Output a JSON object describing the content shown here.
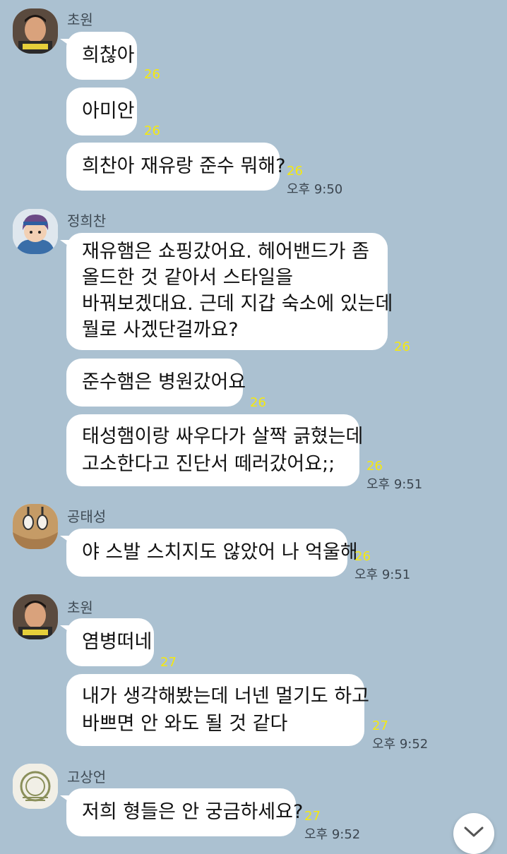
{
  "blocks": [
    {
      "sender": "초원",
      "avatar_icon": "chowon-avatar",
      "messages": [
        {
          "text": "희찮아",
          "count": "26"
        },
        {
          "text": "아미안",
          "count": "26"
        },
        {
          "text": "희찬아 재유랑 준수 뭐해?",
          "count": "26",
          "time": "오후 9:50"
        }
      ]
    },
    {
      "sender": "정희찬",
      "avatar_icon": "heechan-avatar",
      "messages": [
        {
          "lines": [
            "재유햄은 쇼핑갔어요. 헤어밴드가 좀",
            "올드한 것 같아서 스타일을",
            "바꿔보겠대요. 근데 지갑 숙소에 있는데",
            "뭘로 사겠단걸까요?"
          ],
          "count": "26"
        },
        {
          "text": "준수햄은 병원갔어요",
          "count": "26"
        },
        {
          "lines": [
            "태성햄이랑 싸우다가 살짝 긁혔는데",
            "고소한다고 진단서 떼러갔어요;;"
          ],
          "count": "26",
          "time": "오후 9:51"
        }
      ]
    },
    {
      "sender": "공태성",
      "avatar_icon": "taesung-avatar",
      "messages": [
        {
          "text": "야 스발 스치지도 않았어 나 억울해",
          "count": "26",
          "time": "오후 9:51"
        }
      ]
    },
    {
      "sender": "초원",
      "avatar_icon": "chowon-avatar",
      "messages": [
        {
          "text": "염병떠네",
          "count": "27"
        },
        {
          "lines": [
            "내가 생각해봤는데 너넨 멀기도 하고",
            "바쁘면 안 와도 될 것 같다"
          ],
          "count": "27",
          "time": "오후 9:52"
        }
      ]
    },
    {
      "sender": "고상언",
      "avatar_icon": "sangeon-avatar",
      "messages": [
        {
          "text": "저희 형들은 안 궁금하세요?",
          "count": "27",
          "time": "오후 9:52"
        }
      ]
    }
  ],
  "scroll_button_icon": "chevron-down-icon",
  "colors": {
    "background": "#abc1d1",
    "bubble": "#ffffff",
    "unread": "#f5e90f"
  }
}
